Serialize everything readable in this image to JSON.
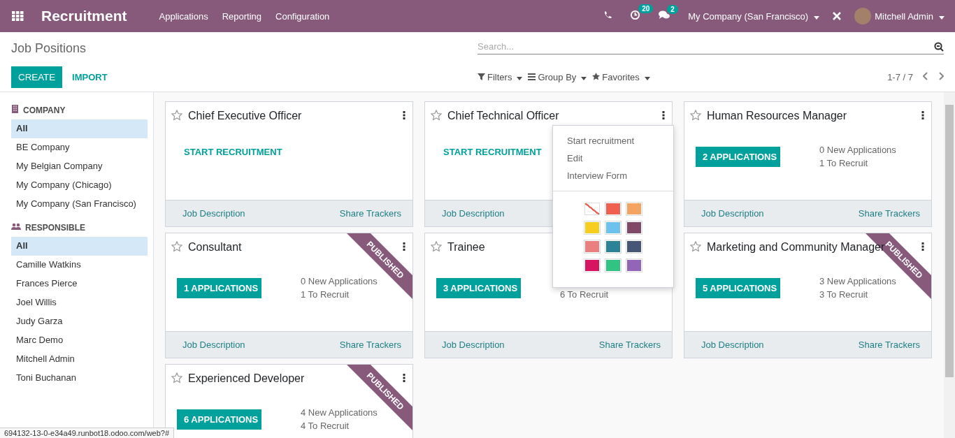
{
  "navbar": {
    "app_name": "Recruitment",
    "menus": [
      "Applications",
      "Reporting",
      "Configuration"
    ],
    "activity_count": "20",
    "message_count": "2",
    "company": "My Company (San Francisco)",
    "user": "Mitchell Admin"
  },
  "control_panel": {
    "title": "Job Positions",
    "create": "CREATE",
    "import": "IMPORT",
    "search": {
      "placeholder": "Search..."
    },
    "filters": [
      "Filters",
      "Group By",
      "Favorites"
    ],
    "pager": "1-7 / 7"
  },
  "sidebar": {
    "sections": [
      {
        "title": "COMPANY",
        "kind": "building",
        "items": [
          {
            "label": "All",
            "selected": true
          },
          {
            "label": "BE Company",
            "selected": false
          },
          {
            "label": "My Belgian Company",
            "selected": false
          },
          {
            "label": "My Company (Chicago)",
            "selected": false
          },
          {
            "label": "My Company (San Francisco)",
            "selected": false
          }
        ]
      },
      {
        "title": "RESPONSIBLE",
        "kind": "users",
        "items": [
          {
            "label": "All",
            "selected": true
          },
          {
            "label": "Camille Watkins",
            "selected": false
          },
          {
            "label": "Frances Pierce",
            "selected": false
          },
          {
            "label": "Joel Willis",
            "selected": false
          },
          {
            "label": "Judy Garza",
            "selected": false
          },
          {
            "label": "Marc Demo",
            "selected": false
          },
          {
            "label": "Mitchell Admin",
            "selected": false
          },
          {
            "label": "Toni Buchanan",
            "selected": false
          }
        ]
      }
    ]
  },
  "cards": [
    {
      "title": "Chief Executive Officer",
      "favorite": false,
      "menu_icon": true,
      "action": {
        "kind": "start",
        "label": "START RECRUITMENT"
      },
      "links": [
        "Job Description",
        "Share Trackers"
      ]
    },
    {
      "title": "Chief Technical Officer",
      "favorite": false,
      "menu_icon": true,
      "action": {
        "kind": "start",
        "label": "START RECRUITMENT"
      },
      "links": [
        "Job Description"
      ]
    },
    {
      "title": "Human Resources Manager",
      "favorite": false,
      "menu_icon": true,
      "action": {
        "kind": "applications",
        "label": "2 APPLICATIONS"
      },
      "stats": [
        "0 New Applications",
        "1 To Recruit"
      ],
      "links": [
        "Job Description",
        "Share Trackers"
      ]
    },
    {
      "title": "Consultant",
      "favorite": false,
      "menu_icon": true,
      "ribbon": "PUBLISHED",
      "action": {
        "kind": "applications",
        "label": "1 APPLICATIONS"
      },
      "stats": [
        "0 New Applications",
        "1 To Recruit"
      ],
      "links": [
        "Job Description",
        "Share Trackers"
      ]
    },
    {
      "title": "Trainee",
      "favorite": false,
      "menu_icon": false,
      "action": {
        "kind": "applications",
        "label": "3 APPLICATIONS"
      },
      "stats": [
        "6 To Recruit"
      ],
      "links": [
        "Job Description",
        "Share Trackers"
      ]
    },
    {
      "title": "Marketing and Community Manager",
      "favorite": false,
      "menu_icon": true,
      "ribbon": "PUBLISHED",
      "action": {
        "kind": "applications",
        "label": "5 APPLICATIONS"
      },
      "stats": [
        "3 New Applications",
        "3 To Recruit"
      ],
      "links": [
        "Job Description",
        "Share Trackers"
      ]
    },
    {
      "title": "Experienced Developer",
      "favorite": false,
      "menu_icon": true,
      "ribbon": "PUBLISHED",
      "action": {
        "kind": "applications",
        "label": "6 APPLICATIONS"
      },
      "stats": [
        "4 New Applications",
        "4 To Recruit"
      ]
    }
  ],
  "card_menu": {
    "items": [
      "Start recruitment",
      "Edit",
      "Interview Form"
    ],
    "colors": [
      {
        "kind": "none",
        "color": "#ffffff"
      },
      {
        "kind": "swatch",
        "color": "#f06050"
      },
      {
        "kind": "swatch",
        "color": "#f4a460"
      },
      {
        "kind": "swatch",
        "color": "#f7cd1f"
      },
      {
        "kind": "swatch",
        "color": "#6cc1ed"
      },
      {
        "kind": "swatch",
        "color": "#814968"
      },
      {
        "kind": "swatch",
        "color": "#eb7e7f"
      },
      {
        "kind": "swatch",
        "color": "#2c8397"
      },
      {
        "kind": "swatch",
        "color": "#475577"
      },
      {
        "kind": "swatch",
        "color": "#d6145f"
      },
      {
        "kind": "swatch",
        "color": "#30c381"
      },
      {
        "kind": "swatch",
        "color": "#9365b8"
      }
    ]
  },
  "status_url": "694132-13-0-e34a49.runbot18.odoo.com/web?#"
}
